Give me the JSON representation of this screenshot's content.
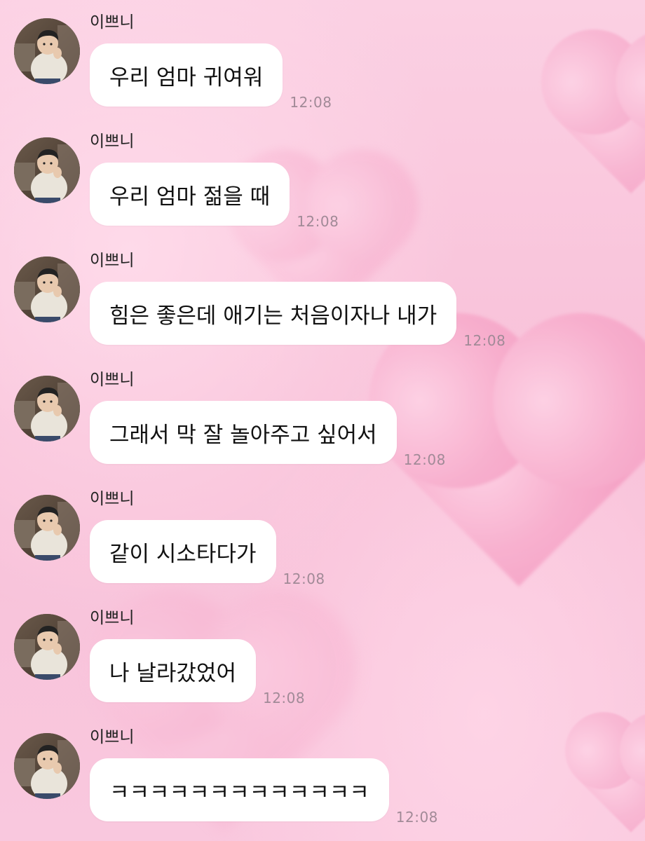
{
  "chat": {
    "messages": [
      {
        "sender": "이쁘니",
        "text": "우리 엄마 귀여워",
        "time": "12:08"
      },
      {
        "sender": "이쁘니",
        "text": "우리 엄마 젊을 때",
        "time": "12:08"
      },
      {
        "sender": "이쁘니",
        "text": "힘은 좋은데 애기는 처음이자나 내가",
        "time": "12:08"
      },
      {
        "sender": "이쁘니",
        "text": "그래서 막 잘 놀아주고 싶어서",
        "time": "12:08"
      },
      {
        "sender": "이쁘니",
        "text": "같이 시소타다가",
        "time": "12:08"
      },
      {
        "sender": "이쁘니",
        "text": "나 날라갔었어",
        "time": "12:08"
      },
      {
        "sender": "이쁘니",
        "text": "ㅋㅋㅋㅋㅋㅋㅋㅋㅋㅋㅋㅋㅋ",
        "time": "12:08"
      }
    ]
  },
  "colors": {
    "background": "#f9c5dc",
    "bubble": "#ffffff",
    "time_text": "#a18a97"
  },
  "icons": {
    "avatar": "profile-photo"
  }
}
